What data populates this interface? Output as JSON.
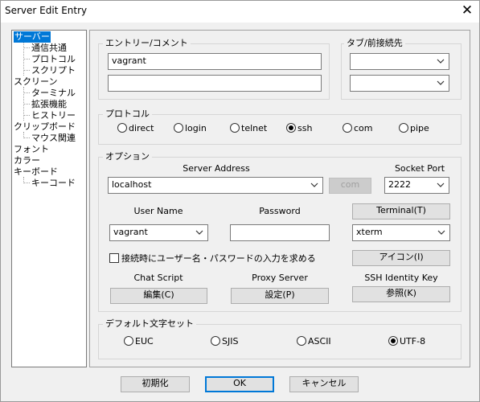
{
  "window": {
    "title": "Server Edit Entry",
    "close_glyph": "✕"
  },
  "tree": {
    "items": [
      {
        "label": "サーバー",
        "level": 0,
        "selected": true
      },
      {
        "label": "通信共通",
        "level": 1
      },
      {
        "label": "プロトコル",
        "level": 1
      },
      {
        "label": "スクリプト",
        "level": 1
      },
      {
        "label": "スクリーン",
        "level": 0
      },
      {
        "label": "ターミナル",
        "level": 1
      },
      {
        "label": "拡張機能",
        "level": 1
      },
      {
        "label": "ヒストリー",
        "level": 1
      },
      {
        "label": "クリップボード",
        "level": 0
      },
      {
        "label": "マウス関連",
        "level": 1
      },
      {
        "label": "フォント",
        "level": 0
      },
      {
        "label": "カラー",
        "level": 0
      },
      {
        "label": "キーボード",
        "level": 0
      },
      {
        "label": "キーコード",
        "level": 1
      }
    ]
  },
  "entry": {
    "group_label": "エントリー/コメント",
    "entry_value": "vagrant",
    "comment_value": ""
  },
  "tab": {
    "group_label": "タブ/前接続先",
    "tab_value": "",
    "prev_value": ""
  },
  "protocol": {
    "group_label": "プロトコル",
    "options": [
      "direct",
      "login",
      "telnet",
      "ssh",
      "com",
      "pipe"
    ],
    "selected": "ssh"
  },
  "options": {
    "group_label": "オプション",
    "server_address_label": "Server Address",
    "server_address_value": "localhost",
    "com_button": "com",
    "socket_port_label": "Socket Port",
    "socket_port_value": "2222",
    "user_name_label": "User Name",
    "user_name_value": "vagrant",
    "password_label": "Password",
    "password_value": "",
    "terminal_button": "Terminal(T)",
    "terminal_value": "xterm",
    "prompt_checkbox_label": "接続時にユーザー名・パスワードの入力を求める",
    "prompt_checked": false,
    "icon_button": "アイコン(I)",
    "chat_script_label": "Chat Script",
    "chat_script_button": "編集(C)",
    "proxy_server_label": "Proxy Server",
    "proxy_server_button": "設定(P)",
    "ssh_identity_label": "SSH Identity Key",
    "ssh_identity_button": "参照(K)"
  },
  "charset": {
    "group_label": "デフォルト文字セット",
    "options": [
      "EUC",
      "SJIS",
      "ASCII",
      "UTF-8"
    ],
    "selected": "UTF-8"
  },
  "footer": {
    "init_button": "初期化",
    "ok_button": "OK",
    "cancel_button": "キャンセル"
  },
  "colors": {
    "selection": "#0078d7",
    "dialog_bg": "#f0f0f0"
  }
}
